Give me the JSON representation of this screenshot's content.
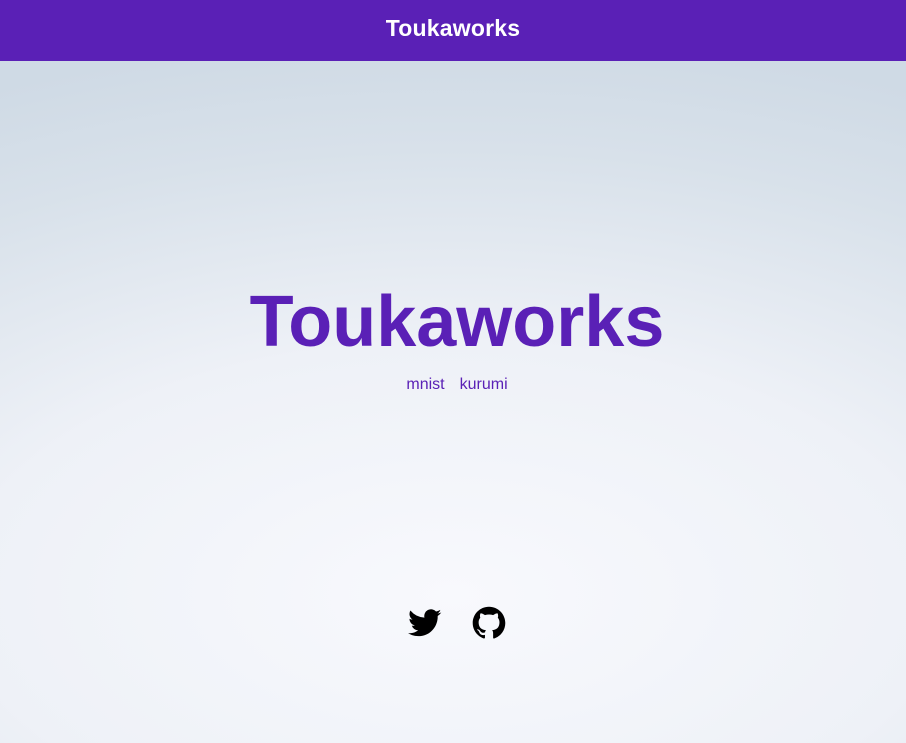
{
  "header": {
    "title": "Toukaworks"
  },
  "hero": {
    "title": "Toukaworks",
    "links": [
      {
        "label": "mnist"
      },
      {
        "label": "kurumi"
      }
    ]
  },
  "social": {
    "icons": [
      "twitter-icon",
      "github-icon"
    ]
  },
  "colors": {
    "brand": "#5a20b6",
    "header_text": "#ffffff",
    "icon": "#000000"
  }
}
